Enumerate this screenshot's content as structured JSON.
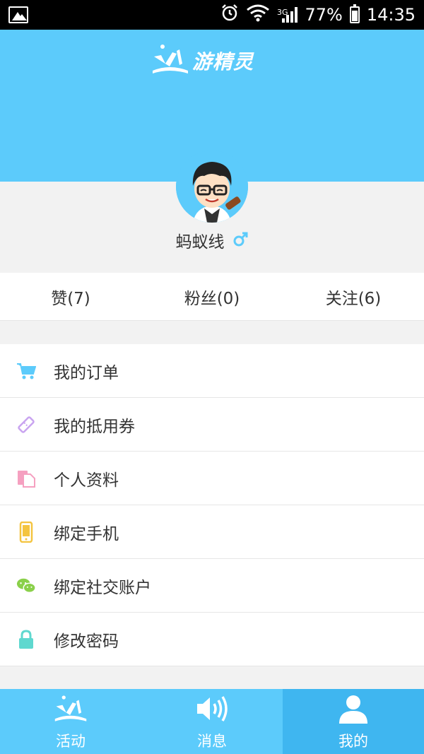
{
  "status_bar": {
    "network": "3G",
    "battery": "77%",
    "battery_level": 0.77,
    "time": "14:35"
  },
  "header": {
    "logo_text": "游精灵"
  },
  "profile": {
    "username": "蚂蚁线",
    "gender_icon": "male-icon"
  },
  "stats": [
    {
      "label": "赞(7)"
    },
    {
      "label": "粉丝(0)"
    },
    {
      "label": "关注(6)"
    }
  ],
  "menu": [
    {
      "label": "我的订单",
      "icon": "cart-icon",
      "color": "#5ccbfb"
    },
    {
      "label": "我的抵用券",
      "icon": "coupon-icon",
      "color": "#c9a4f0"
    },
    {
      "label": "个人资料",
      "icon": "document-icon",
      "color": "#f5a0c0"
    },
    {
      "label": "绑定手机",
      "icon": "phone-icon",
      "color": "#f4c440"
    },
    {
      "label": "绑定社交账户",
      "icon": "wechat-icon",
      "color": "#8ad04a"
    },
    {
      "label": "修改密码",
      "icon": "lock-icon",
      "color": "#5fd8cf"
    }
  ],
  "tabs": [
    {
      "label": "活动",
      "icon": "activity-icon",
      "active": false
    },
    {
      "label": "消息",
      "icon": "speaker-icon",
      "active": false
    },
    {
      "label": "我的",
      "icon": "person-icon",
      "active": true
    }
  ],
  "colors": {
    "primary": "#5ccbfb",
    "active_tab": "#3fb6f0",
    "background": "#f2f2f2"
  }
}
